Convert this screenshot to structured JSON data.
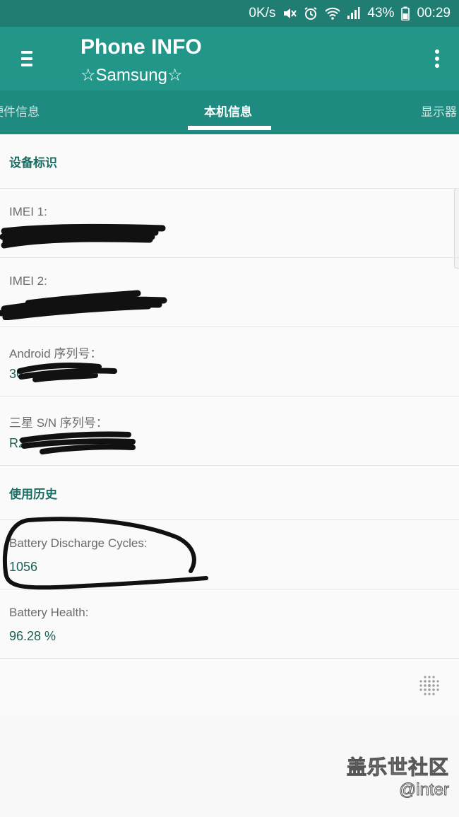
{
  "status_bar": {
    "speed": "0K/s",
    "battery_percent": "43%",
    "time": "00:29",
    "icons": [
      "mute-icon",
      "alarm-icon",
      "wifi-icon",
      "signal-icon",
      "battery-icon"
    ]
  },
  "app_bar": {
    "title": "Phone INFO",
    "subtitle": "☆Samsung☆",
    "menu_icon": "hamburger-menu-icon",
    "overflow_icon": "more-vert-icon"
  },
  "tabs": {
    "left": "硬件信息",
    "active": "本机信息",
    "right": "显示器"
  },
  "sections": {
    "device_id": {
      "header": "设备标识",
      "imei1_label": "IMEI 1:",
      "imei2_label": "IMEI 2:",
      "android_serial_label": "Android 序列号：",
      "android_serial_value": "36",
      "samsung_sn_label": "三星 S/N 序列号：",
      "samsung_sn_value": "R2"
    },
    "usage_history": {
      "header": "使用历史",
      "discharge_label": "Battery Discharge Cycles:",
      "discharge_value": "1056",
      "health_label": "Battery Health:",
      "health_value": "96.28 %"
    }
  },
  "watermark": {
    "site": "盖乐世社区",
    "user": "@inter"
  },
  "colors": {
    "status_bar": "#1f7d72",
    "app_bar": "#23968a",
    "tab_bar": "#1f8a7f",
    "section_header": "#1a6d63",
    "value_text": "#1b5f57"
  }
}
